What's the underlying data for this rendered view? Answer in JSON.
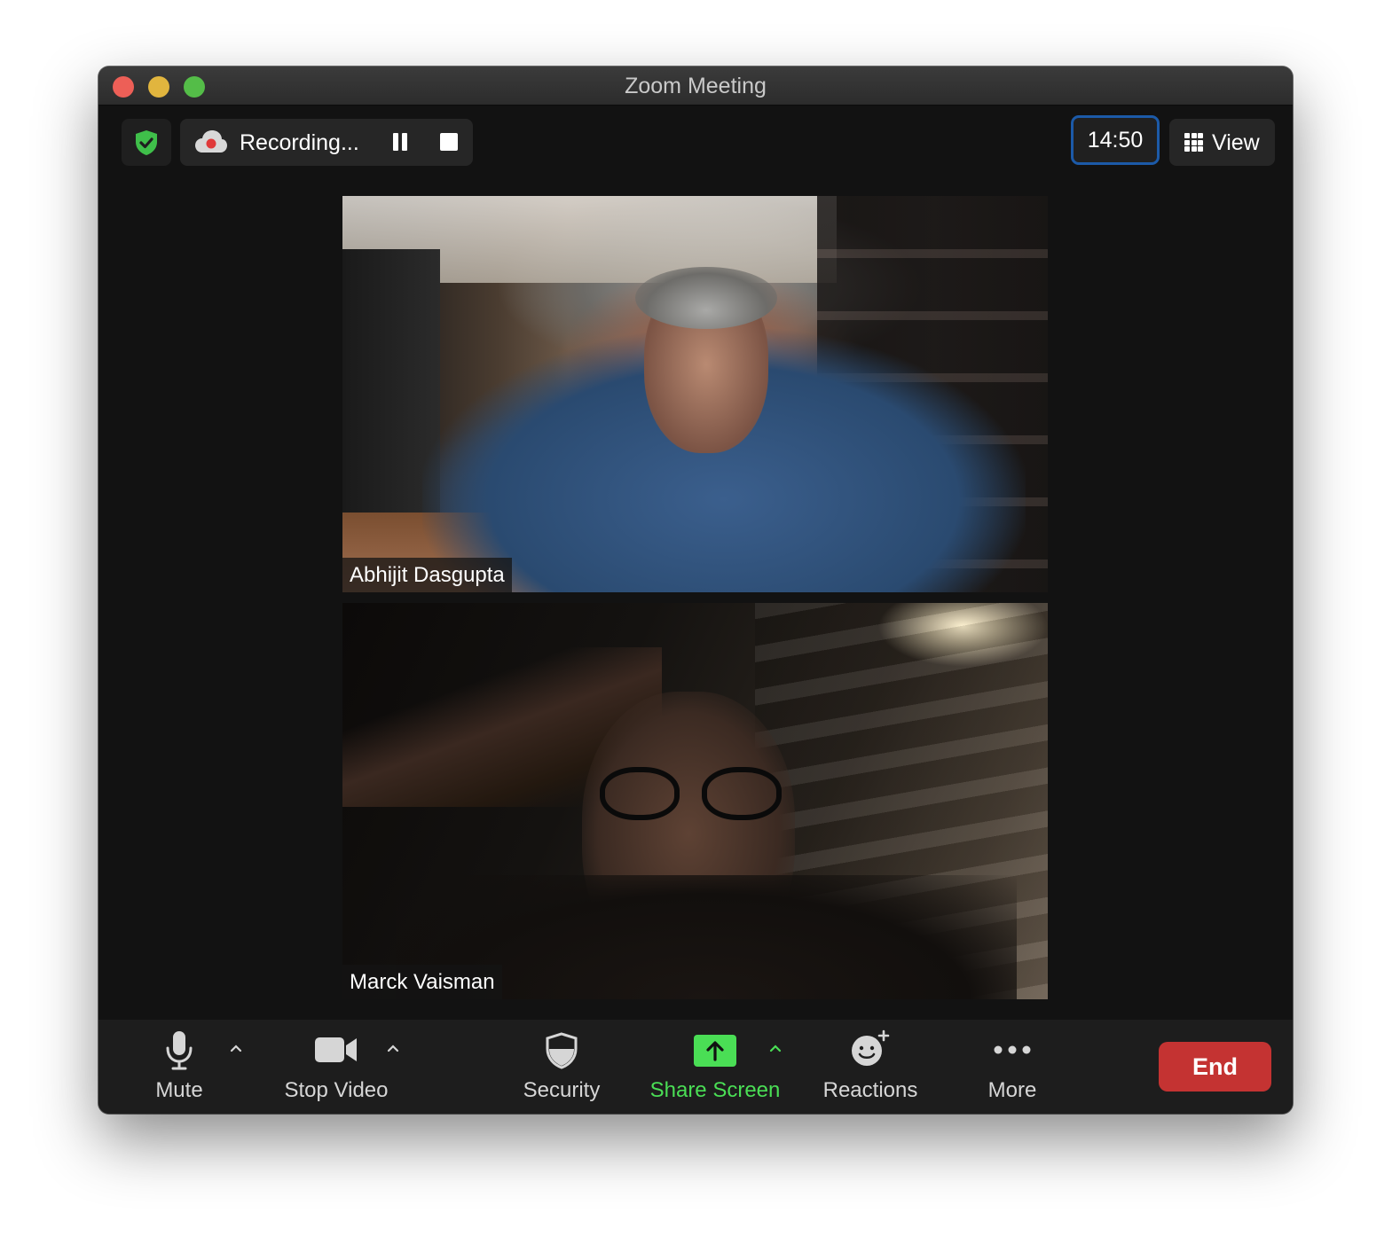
{
  "window": {
    "title": "Zoom Meeting"
  },
  "header": {
    "recording_label": "Recording...",
    "timer": "14:50",
    "view_label": "View"
  },
  "participants": [
    {
      "name": "Abhijit Dasgupta"
    },
    {
      "name": "Marck Vaisman"
    }
  ],
  "toolbar": {
    "mute_label": "Mute",
    "stop_video_label": "Stop Video",
    "security_label": "Security",
    "share_screen_label": "Share Screen",
    "reactions_label": "Reactions",
    "more_label": "More",
    "end_label": "End"
  },
  "icons": {
    "security_badge": "shield-check-icon",
    "recording": "cloud-record-icon",
    "pause": "pause-icon",
    "stop": "stop-icon",
    "view": "grid-icon",
    "mute": "microphone-icon",
    "video": "video-camera-icon",
    "security": "shield-icon",
    "share": "share-screen-icon",
    "reactions": "emoji-add-icon",
    "more": "ellipsis-icon",
    "caret": "chevron-up-icon"
  },
  "colors": {
    "accent_green": "#4ade55",
    "end_red": "#c43332",
    "timer_border": "#1c5aa8",
    "window_bg": "#121212"
  }
}
